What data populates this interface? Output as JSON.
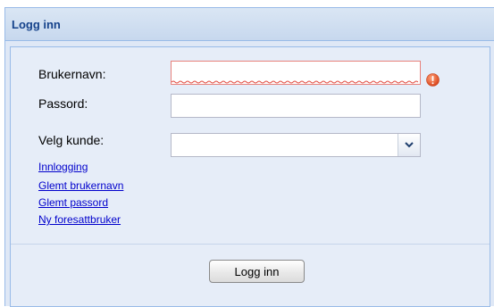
{
  "panel": {
    "title": "Logg inn"
  },
  "form": {
    "username": {
      "label": "Brukernavn:",
      "value": "",
      "status": "invalid"
    },
    "password": {
      "label": "Passord:",
      "value": ""
    },
    "customer": {
      "label": "Velg kunde:",
      "selected": ""
    }
  },
  "links": [
    {
      "label": "Innlogging"
    },
    {
      "label": "Glemt brukernavn"
    },
    {
      "label": "Glemt passord"
    },
    {
      "label": "Ny foresattbruker"
    }
  ],
  "actions": {
    "login_label": "Logg inn"
  },
  "icons": {
    "error": "error-icon",
    "dropdown": "chevron-down-icon"
  },
  "colors": {
    "header_text": "#15428b",
    "panel_bg": "#dfe8f6",
    "border": "#99bbe8",
    "link": "#0000cc",
    "error": "#e8827c",
    "error_icon": "#e05a2a"
  }
}
